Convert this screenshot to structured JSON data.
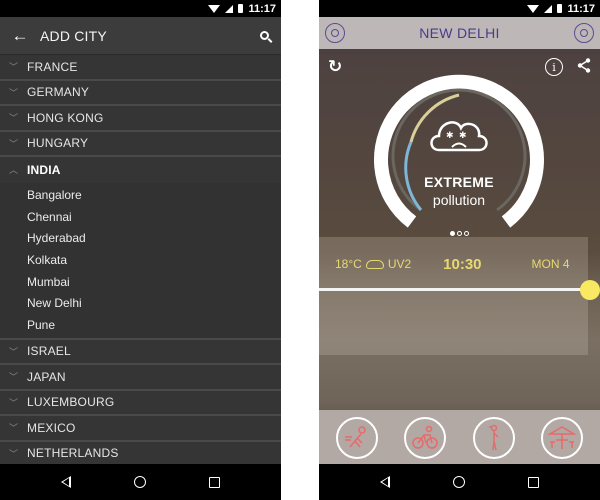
{
  "status_bar": {
    "time": "11:17"
  },
  "left_screen": {
    "app_bar": {
      "title": "ADD CITY",
      "back_icon": "arrow-left-icon",
      "search_icon": "search-icon"
    },
    "countries_before": [
      "FRANCE",
      "GERMANY",
      "HONG KONG",
      "HUNGARY"
    ],
    "expanded_country": {
      "name": "INDIA",
      "cities": [
        "Bangalore",
        "Chennai",
        "Hyderabad",
        "Kolkata",
        "Mumbai",
        "New Delhi",
        "Pune"
      ]
    },
    "countries_after": [
      "ISRAEL",
      "JAPAN",
      "LUXEMBOURG",
      "MEXICO",
      "NETHERLANDS"
    ]
  },
  "right_screen": {
    "header": {
      "title": "NEW DELHI",
      "left_icon": "location-icon",
      "right_icon": "profile-icon"
    },
    "top_icons": {
      "refresh": "↻",
      "info": "i",
      "share": "share-icon"
    },
    "gauge": {
      "level": "EXTREME",
      "label": "pollution",
      "page_count": 3,
      "active_page": 1
    },
    "weather": {
      "temperature": "18°C",
      "uv": "UV2",
      "time": "10:30",
      "date": "MON 4"
    },
    "time_slider": {
      "position_fraction": 1.0
    },
    "activities": [
      "running-icon",
      "cycling-icon",
      "walking-icon",
      "outdoor-dining-icon"
    ],
    "colors": {
      "accent_yellow": "#f8e862",
      "header_purple": "#4b3c8a",
      "activity_red": "#e86a6a"
    }
  }
}
